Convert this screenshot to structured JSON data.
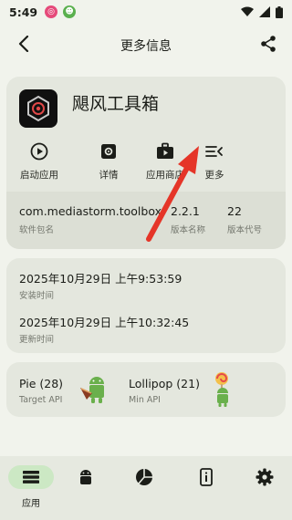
{
  "status_bar": {
    "time": "5:49"
  },
  "app_bar": {
    "title": "更多信息"
  },
  "app": {
    "name": "飓风工具箱"
  },
  "actions": [
    {
      "label": "启动应用",
      "icon": "play-circle-icon"
    },
    {
      "label": "详情",
      "icon": "settings-icon"
    },
    {
      "label": "应用商店",
      "icon": "store-icon"
    },
    {
      "label": "更多",
      "icon": "more-list-icon"
    }
  ],
  "package": {
    "name_value": "com.mediastorm.toolbox",
    "name_label": "软件包名",
    "version_value": "2.2.1",
    "version_label": "版本名称",
    "code_value": "22",
    "code_label": "版本代号"
  },
  "times": {
    "install_value": "2025年10月29日 上午9:53:59",
    "install_label": "安装时间",
    "update_value": "2025年10月29日 上午10:32:45",
    "update_label": "更新时间"
  },
  "api": {
    "target_value": "Pie (28)",
    "target_label": "Target API",
    "min_value": "Lollipop (21)",
    "min_label": "Min API"
  },
  "bottom_nav": {
    "active_label": "应用"
  },
  "colors": {
    "accent": "#cce8c4",
    "arrow": "#e53528",
    "background": "#f1f3ec"
  }
}
